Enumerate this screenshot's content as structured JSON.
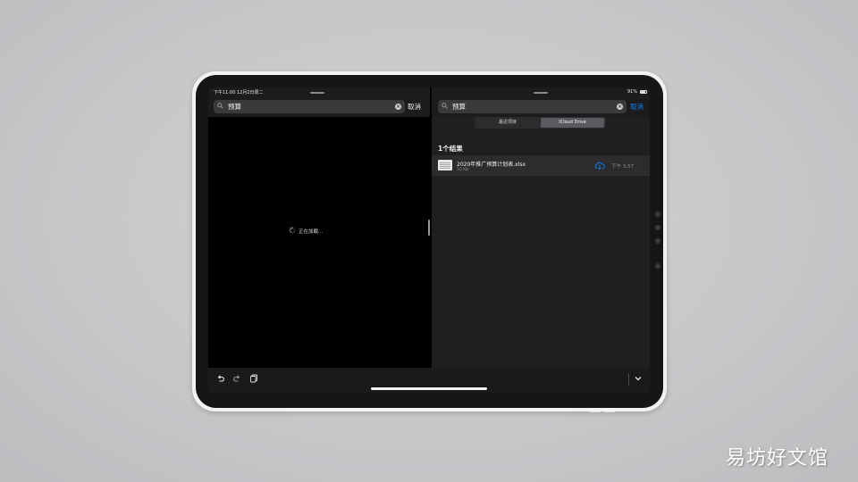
{
  "status": {
    "time_date": "下午11:00  12月2日周二",
    "battery": "91%"
  },
  "left_pane": {
    "search_query": "预算",
    "cancel_label": "取消",
    "loading_text": "正在加载..."
  },
  "right_pane": {
    "search_query": "预算",
    "cancel_label": "取消",
    "segments": [
      "最近项目",
      "iCloud Drive"
    ],
    "selected_segment": "iCloud Drive",
    "result_count": "1个结果",
    "results": [
      {
        "name": "2020年推广预算计划表.xlsx",
        "size": "16 KB",
        "time": "下午 3:57"
      }
    ]
  },
  "watermark": "易坊好文馆",
  "colors": {
    "accent": "#0a84ff",
    "screen_dark": "#1f1f21",
    "background": "#c8c8cb"
  },
  "icons": [
    "search-icon",
    "clear-icon",
    "spinner-icon",
    "cloud-download-icon",
    "undo-icon",
    "redo-icon",
    "paste-icon",
    "chevron-down-icon"
  ]
}
